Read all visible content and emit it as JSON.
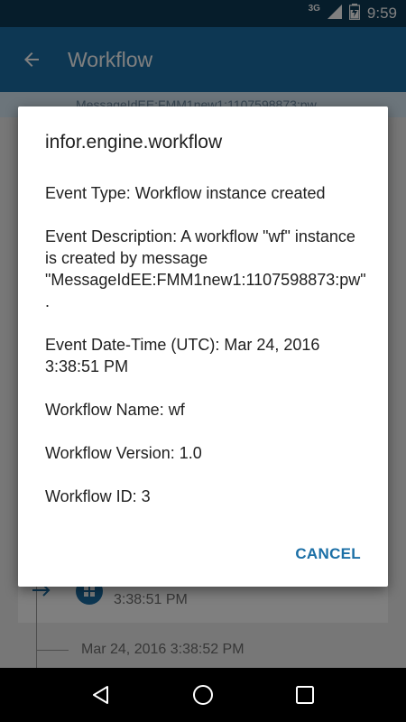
{
  "status_bar": {
    "network": "3G",
    "time": "9:59"
  },
  "app_bar": {
    "title": "Workflow"
  },
  "background": {
    "subheader": "MessageIdEE:FMM1new1:1107598873:pw",
    "event_time": "3:38:51 PM",
    "next_date": "Mar 24, 2016 3:38:52 PM"
  },
  "dialog": {
    "title": "infor.engine.workflow",
    "fields": [
      "Event Type: Workflow instance created",
      "Event Description: A workflow \"wf\" instance is created by message \"MessageIdEE:FMM1new1:1107598873:pw\".",
      "Event Date-Time (UTC): Mar 24, 2016 3:38:51 PM",
      "Workflow Name: wf",
      "Workflow Version: 1.0",
      "Workflow ID: 3"
    ],
    "cancel_label": "CANCEL"
  },
  "colors": {
    "primary": "#1b6fa6",
    "status_bar": "#0d3a57",
    "accent_text": "#1b6fa6"
  }
}
